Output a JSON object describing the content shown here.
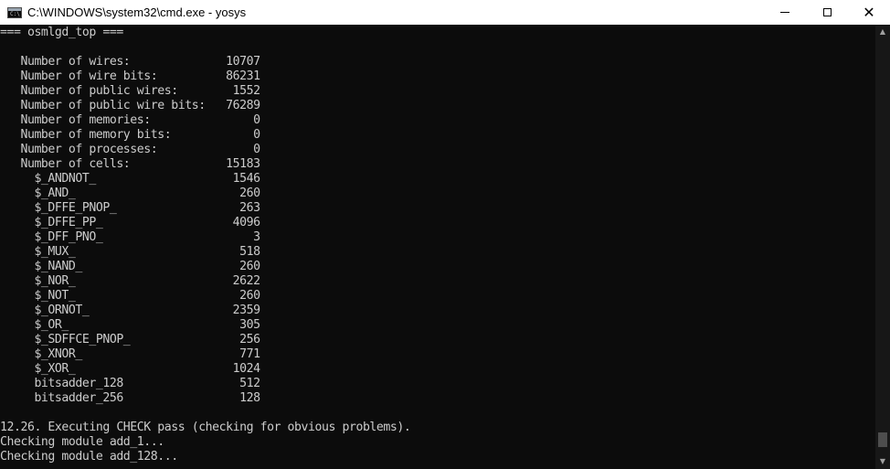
{
  "window": {
    "title": "C:\\WINDOWS\\system32\\cmd.exe - yosys",
    "icon": "cmd-icon",
    "icon_prompt": "C:\\",
    "minimize_glyph": "",
    "close_glyph": "✕"
  },
  "console": {
    "lines": [
      "=== osmlgd_top ===",
      "",
      "   Number of wires:              10707",
      "   Number of wire bits:          86231",
      "   Number of public wires:        1552",
      "   Number of public wire bits:   76289",
      "   Number of memories:               0",
      "   Number of memory bits:            0",
      "   Number of processes:              0",
      "   Number of cells:              15183",
      "     $_ANDNOT_                    1546",
      "     $_AND_                        260",
      "     $_DFFE_PNOP_                  263",
      "     $_DFFE_PP_                   4096",
      "     $_DFF_PNO_                      3",
      "     $_MUX_                        518",
      "     $_NAND_                       260",
      "     $_NOR_                       2622",
      "     $_NOT_                        260",
      "     $_ORNOT_                     2359",
      "     $_OR_                         305",
      "     $_SDFFCE_PNOP_                256",
      "     $_XNOR_                       771",
      "     $_XOR_                       1024",
      "     bitsadder_128                 512",
      "     bitsadder_256                 128",
      "",
      "12.26. Executing CHECK pass (checking for obvious problems).",
      "Checking module add_1...",
      "Checking module add_128..."
    ]
  },
  "scrollbar": {
    "up_glyph": "▲",
    "down_glyph": "▼",
    "position": 0.96
  }
}
